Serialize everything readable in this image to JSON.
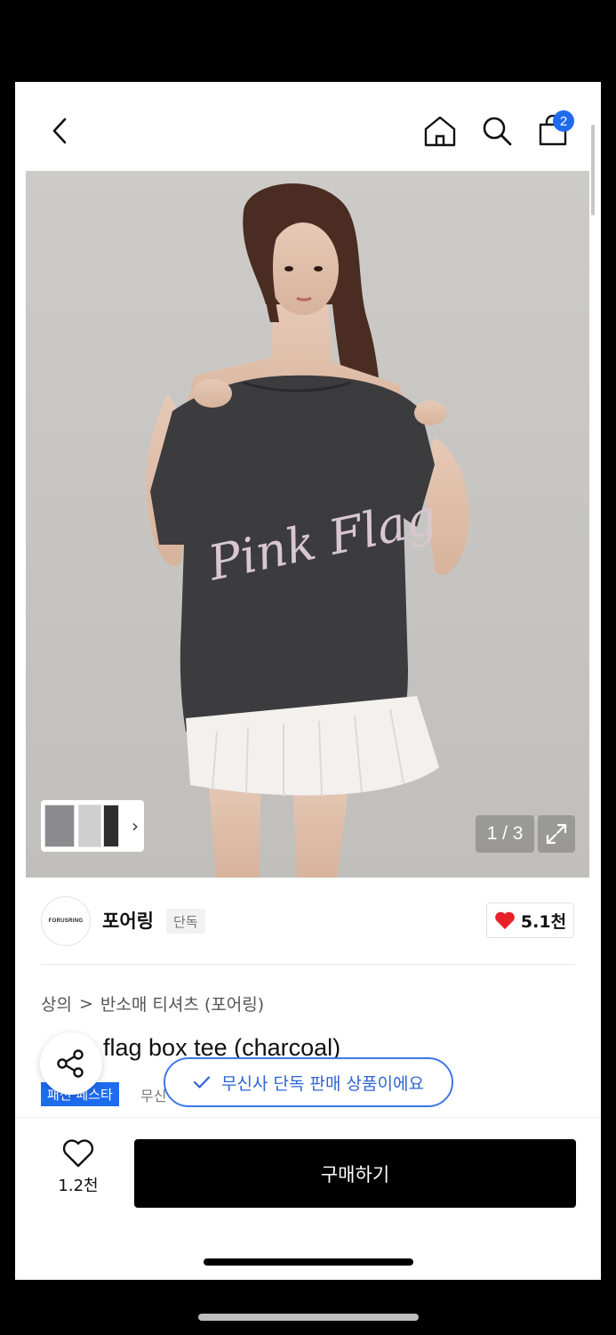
{
  "header": {
    "cart_count": "2"
  },
  "gallery": {
    "counter": "1 / 3",
    "shirt_text": "Pink Flag"
  },
  "brand": {
    "logo_text": "FORUSRING",
    "name": "포어링",
    "tag": "단독",
    "likes": "5.1천"
  },
  "breadcrumb": {
    "category": "상의",
    "separator": ">",
    "subcategory": "반소매 티셔츠 (포어링)"
  },
  "product": {
    "title": "flag box tee (charcoal)",
    "festa_tag": "패션 페스타",
    "festa_extra": "무신"
  },
  "toast": {
    "text": "무신사 단독 판매 상품이에요"
  },
  "bottom_bar": {
    "wish_count": "1.2천",
    "buy_label": "구매하기"
  },
  "colors": {
    "accent_blue": "#1e6bf0",
    "heart_red": "#e8202a",
    "buy_button": "#000000"
  }
}
